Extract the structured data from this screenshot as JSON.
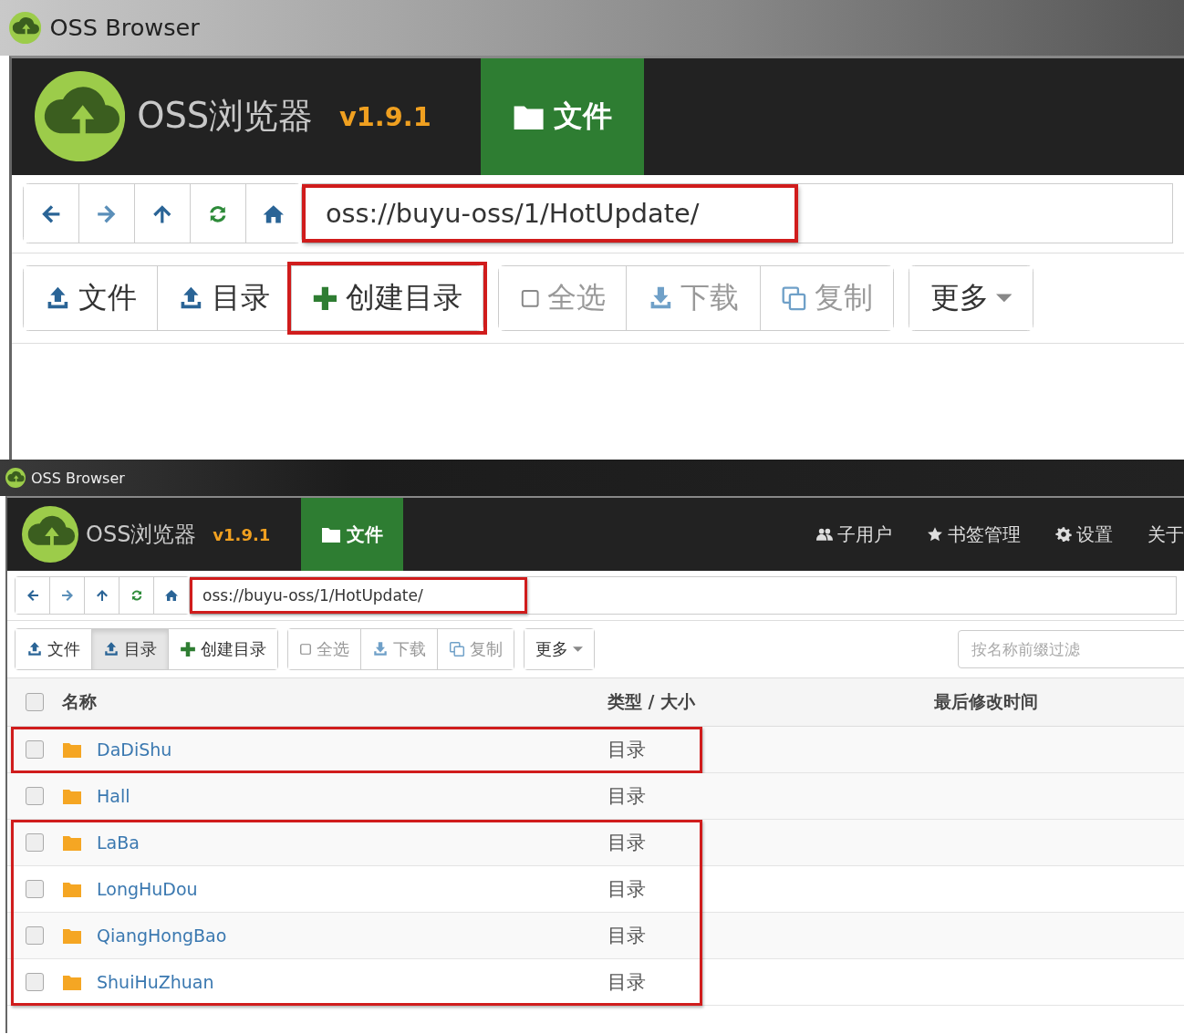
{
  "screenshots": [
    {
      "window": {
        "title": "OSS Browser"
      },
      "app": {
        "name": "OSS浏览器",
        "version": "v1.9.1"
      },
      "nav_tabs": [
        {
          "label": "文件",
          "selected": true
        }
      ],
      "address": {
        "value": "oss://buyu-oss/1/HotUpdate/",
        "highlighted": true
      },
      "toolbar": [
        {
          "buttons": [
            {
              "kind": "upload",
              "label": "文件",
              "selected": false,
              "disabled": false,
              "highlighted": false
            },
            {
              "kind": "upload",
              "label": "目录",
              "selected": false,
              "disabled": false,
              "highlighted": false
            },
            {
              "kind": "add",
              "label": "创建目录",
              "selected": false,
              "disabled": false,
              "highlighted": true
            }
          ]
        },
        {
          "buttons": [
            {
              "kind": "checkbox",
              "label": "全选",
              "selected": false,
              "disabled": true,
              "highlighted": false
            },
            {
              "kind": "download",
              "label": "下载",
              "selected": false,
              "disabled": true,
              "highlighted": false
            },
            {
              "kind": "copy",
              "label": "复制",
              "selected": false,
              "disabled": true,
              "highlighted": false
            }
          ]
        },
        {
          "buttons": [
            {
              "kind": "dropdown",
              "label": "更多",
              "selected": false,
              "disabled": false
            }
          ]
        }
      ]
    },
    {
      "window": {
        "title": "OSS Browser"
      },
      "app": {
        "name": "OSS浏览器",
        "version": "v1.9.1"
      },
      "nav_tabs": [
        {
          "label": "文件",
          "selected": true
        }
      ],
      "menu": [
        {
          "kind": "users",
          "label": "子用户"
        },
        {
          "kind": "star",
          "label": "书签管理"
        },
        {
          "kind": "gear",
          "label": "设置"
        },
        {
          "kind": "none",
          "label": "关于"
        }
      ],
      "address": {
        "value": "oss://buyu-oss/1/HotUpdate/",
        "highlighted": true
      },
      "toolbar": [
        {
          "buttons": [
            {
              "kind": "upload",
              "label": "文件",
              "selected": false,
              "disabled": false,
              "highlighted": false
            },
            {
              "kind": "upload",
              "label": "目录",
              "selected": true,
              "disabled": false,
              "highlighted": false
            },
            {
              "kind": "add",
              "label": "创建目录",
              "selected": false,
              "disabled": false,
              "highlighted": false
            }
          ]
        },
        {
          "buttons": [
            {
              "kind": "checkbox",
              "label": "全选",
              "selected": false,
              "disabled": true,
              "highlighted": false
            },
            {
              "kind": "download",
              "label": "下载",
              "selected": false,
              "disabled": true,
              "highlighted": false
            },
            {
              "kind": "copy",
              "label": "复制",
              "selected": false,
              "disabled": true,
              "highlighted": false
            }
          ]
        },
        {
          "buttons": [
            {
              "kind": "dropdown",
              "label": "更多",
              "selected": false,
              "disabled": false
            }
          ]
        }
      ],
      "filter": {
        "placeholder": "按名称前缀过滤"
      },
      "table": {
        "columns": [
          "名称",
          "类型 / 大小",
          "最后修改时间"
        ],
        "header_checked": false,
        "rows": [
          {
            "name": "DaDiShu",
            "type": "目录",
            "checked": false,
            "highlighted": true
          },
          {
            "name": "Hall",
            "type": "目录",
            "checked": false,
            "highlighted": false
          },
          {
            "name": "LaBa",
            "type": "目录",
            "checked": false,
            "highlighted": true
          },
          {
            "name": "LongHuDou",
            "type": "目录",
            "checked": false,
            "highlighted": true
          },
          {
            "name": "QiangHongBao",
            "type": "目录",
            "checked": false,
            "highlighted": true
          },
          {
            "name": "ShuiHuZhuan",
            "type": "目录",
            "checked": false,
            "highlighted": true
          }
        ]
      }
    }
  ]
}
